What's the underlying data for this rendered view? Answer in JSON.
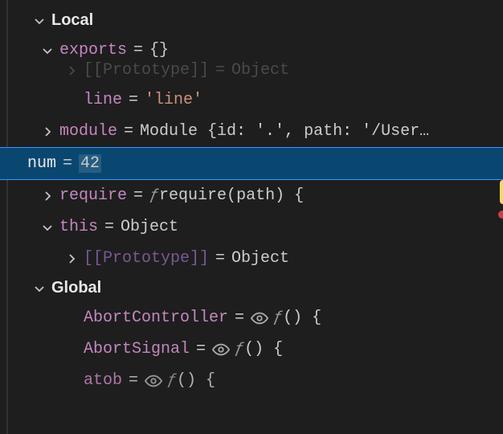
{
  "scopes": {
    "local": {
      "label": "Local",
      "vars": {
        "exports": {
          "name": "exports",
          "value": "{}"
        },
        "ghost_proto": {
          "name": "[[Prototype]]",
          "value": "Object"
        },
        "line": {
          "name": "line",
          "value": "'line'"
        },
        "module": {
          "name": "module",
          "value": "Module {id: '.', path: '/User…"
        },
        "num": {
          "name": "num",
          "value": "42"
        },
        "require": {
          "name": "require",
          "value_f": "ƒ",
          "value_rest": " require(path) {"
        },
        "this": {
          "name": "this",
          "value": "Object"
        },
        "this_proto": {
          "name": "[[Prototype]]",
          "value": "Object"
        }
      }
    },
    "global": {
      "label": "Global",
      "vars": {
        "abortController": {
          "name": "AbortController",
          "value_f": "ƒ",
          "value_rest": " () {"
        },
        "abortSignal": {
          "name": "AbortSignal",
          "value_f": "ƒ",
          "value_rest": " () {"
        },
        "atob": {
          "name": "atob",
          "value_f": "ƒ",
          "value_rest": " () {"
        }
      }
    }
  },
  "equals": "="
}
